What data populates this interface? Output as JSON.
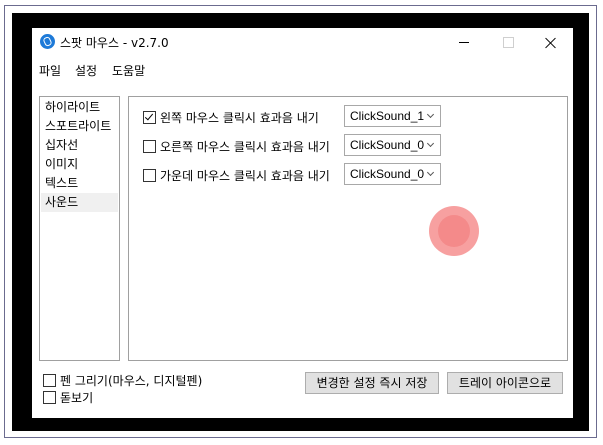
{
  "window": {
    "title": "스팟 마우스 - v2.7.0"
  },
  "menu": {
    "items": [
      "파일",
      "설정",
      "도움말"
    ]
  },
  "categories": {
    "items": [
      "하이라이트",
      "스포트라이트",
      "십자선",
      "이미지",
      "텍스트",
      "사운드"
    ],
    "selected": "사운드"
  },
  "sound_settings": {
    "rows": [
      {
        "label": "왼쪽 마우스 클릭시 효과음 내기",
        "checked": true,
        "value": "ClickSound_1"
      },
      {
        "label": "오른쪽 마우스 클릭시 효과음 내기",
        "checked": false,
        "value": "ClickSound_0"
      },
      {
        "label": "가운데 마우스 클릭시 효과음 내기",
        "checked": false,
        "value": "ClickSound_0"
      }
    ]
  },
  "bottom": {
    "pen_label": "펜 그리기(마우스, 디지털펜)",
    "pen_checked": false,
    "magnifier_label": "돋보기",
    "magnifier_checked": false,
    "save_button": "변경한 설정 즉시 저장",
    "tray_button": "트레이 아이콘으로"
  },
  "colors": {
    "click_effect": "#f48a8a",
    "app_icon": "#1e7ad8"
  }
}
